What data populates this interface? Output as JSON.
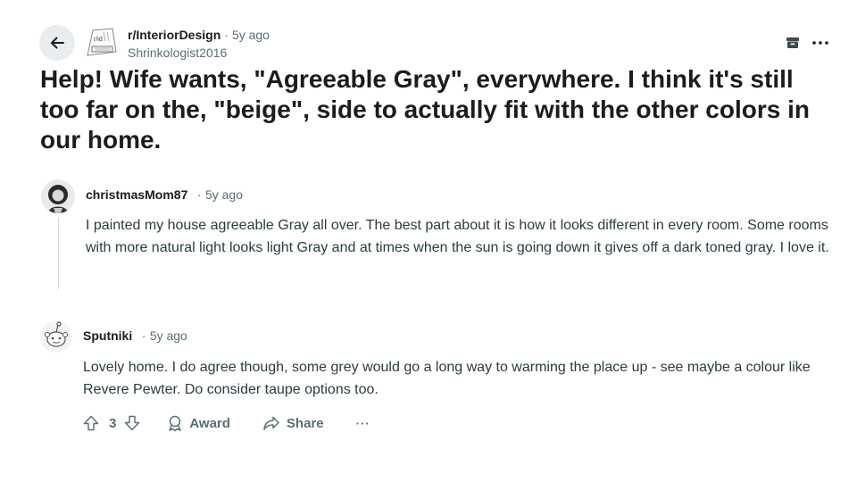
{
  "post": {
    "subreddit": "r/InteriorDesign",
    "separator": "·",
    "time": "5y ago",
    "author": "Shrinkologist2016",
    "title": "Help! Wife wants, \"Agreeable Gray\", everywhere. I think it's still too far on the, \"beige\", side to actually fit with the other colors in our home."
  },
  "comments": [
    {
      "author": "christmasMom87",
      "separator": "·",
      "time": "5y ago",
      "body": "I painted my house agreeable Gray all over. The best part about it is how it looks different in every room. Some rooms with more natural light looks light Gray and at times when the sun is going down it gives off a dark toned gray. I love it."
    },
    {
      "author": "Sputniki",
      "separator": "·",
      "time": "5y ago",
      "body": "Lovely home. I do agree though, some grey would go a long way to warming the place up - see maybe a colour like Revere Pewter. Do consider taupe options too.",
      "votes": "3",
      "award_label": "Award",
      "share_label": "Share",
      "more_label": "···"
    }
  ],
  "icons": {
    "back": "arrow-left-icon",
    "archive": "archive-icon",
    "more": "more-horizontal-icon",
    "upvote": "upvote-arrow-icon",
    "downvote": "downvote-arrow-icon",
    "award": "award-icon",
    "share": "share-icon"
  },
  "colors": {
    "text": "#1c1c1c",
    "meta": "#576f76",
    "body": "#2a3c42",
    "button_bg": "#eaedef"
  }
}
